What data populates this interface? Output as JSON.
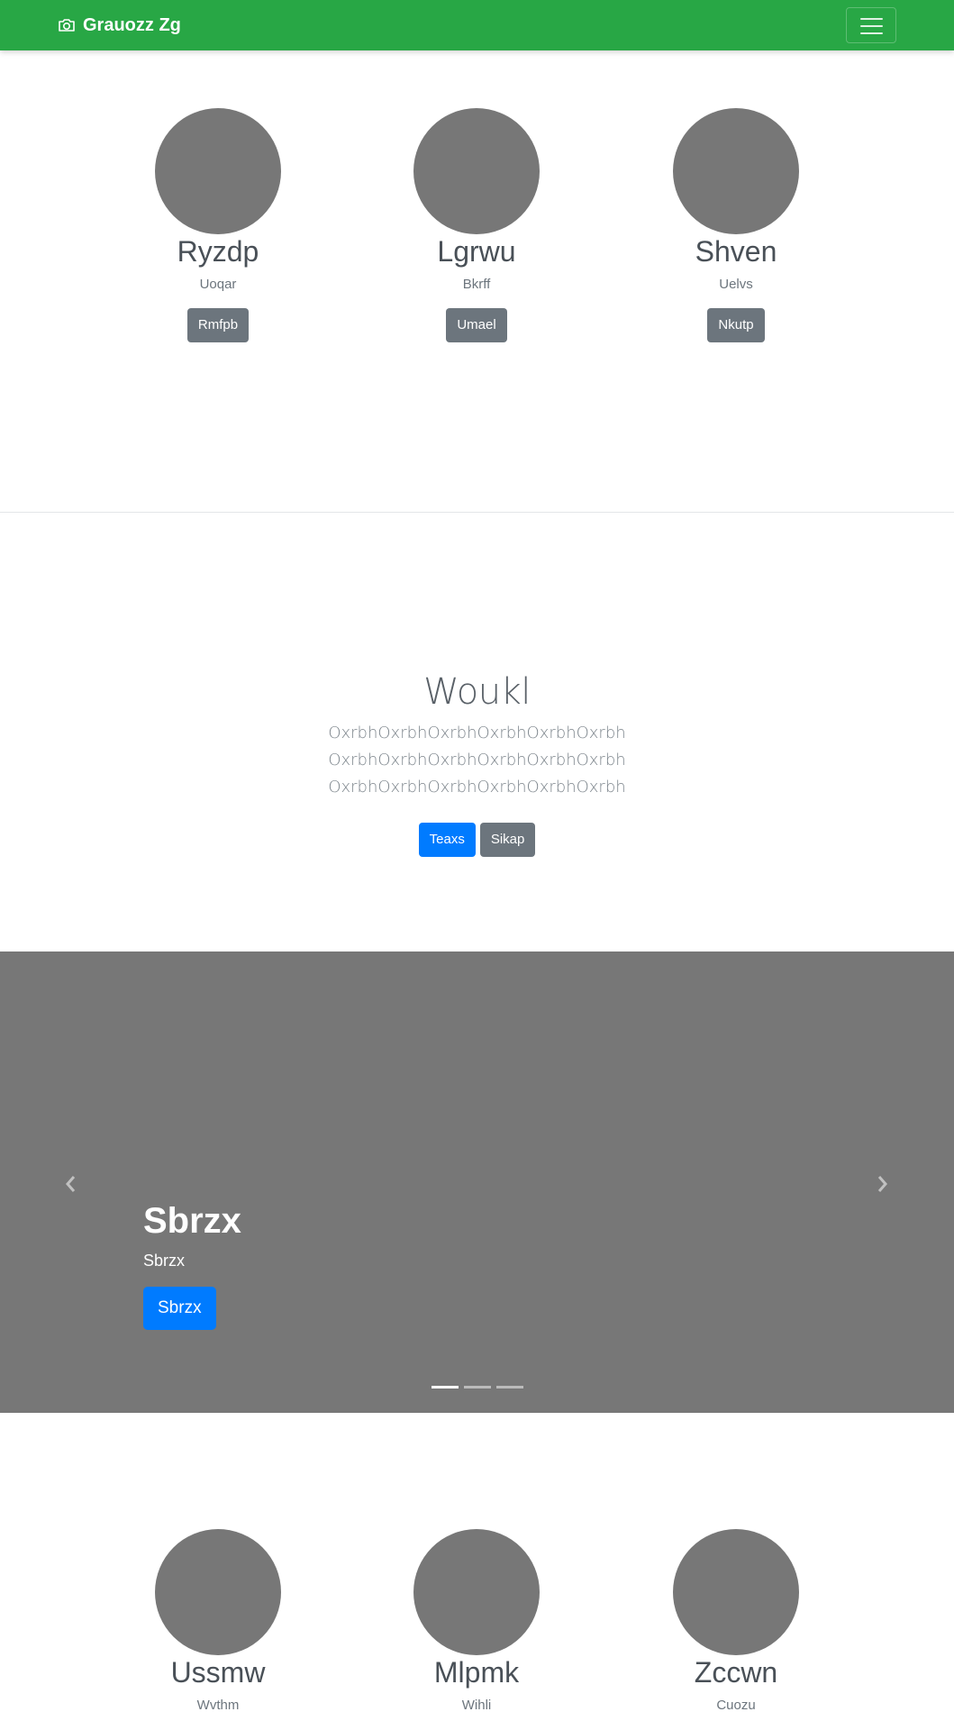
{
  "navbar": {
    "brand": "Grauozz Zg",
    "brand_icon": "camera-icon",
    "toggler_icon": "hamburger-menu-icon",
    "color": "#28a745"
  },
  "team_top": [
    {
      "name": "Ryzdp",
      "subtitle": "Uoqar",
      "button": "Rmfpb"
    },
    {
      "name": "Lgrwu",
      "subtitle": "Bkrff",
      "button": "Umael"
    },
    {
      "name": "Shven",
      "subtitle": "Uelvs",
      "button": "Nkutp"
    }
  ],
  "hero": {
    "title": "Woukl",
    "lines": [
      "OxrbhOxrbhOxrbhOxrbhOxrbhOxrbh",
      "OxrbhOxrbhOxrbhOxrbhOxrbhOxrbh",
      "OxrbhOxrbhOxrbhOxrbhOxrbhOxrbh"
    ],
    "primary_button": "Teaxs",
    "secondary_button": "Sikap"
  },
  "carousel": {
    "title": "Sbrzx",
    "text": "Sbrzx",
    "button": "Sbrzx",
    "prev_icon": "chevron-left-icon",
    "next_icon": "chevron-right-icon",
    "indicator_count": 3,
    "active_index": 0
  },
  "team_bottom": [
    {
      "name": "Ussmw",
      "subtitle": "Wvthm"
    },
    {
      "name": "Mlpmk",
      "subtitle": "Wihli"
    },
    {
      "name": "Zccwn",
      "subtitle": "Cuozu"
    }
  ]
}
